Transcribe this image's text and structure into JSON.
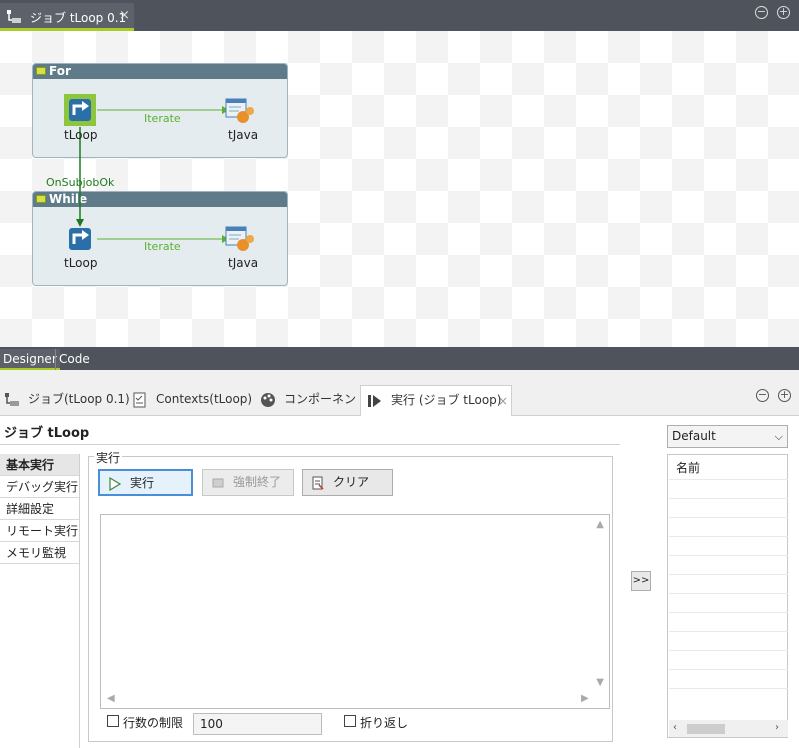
{
  "editor": {
    "tab_title": "ジョブ tLoop 0.1",
    "close_glyph": "×",
    "minimize_glyph": "−",
    "maximize_glyph": "+"
  },
  "canvas": {
    "subjobs": [
      {
        "title": "For",
        "source": "tLoop",
        "target": "tJava",
        "link": "Iterate"
      },
      {
        "title": "While",
        "source": "tLoop",
        "target": "tJava",
        "link": "Iterate"
      }
    ],
    "trigger_label": "OnSubjobOk",
    "tabs": [
      "Designer",
      "Code"
    ]
  },
  "views": {
    "tabs": [
      {
        "label": "ジョブ(tLoop 0.1)",
        "icon": "job-icon"
      },
      {
        "label": "Contexts(tLoop)",
        "icon": "contexts-icon"
      },
      {
        "label": "コンポーネント",
        "icon": "palette-icon"
      },
      {
        "label": "実行 (ジョブ tLoop)",
        "icon": "run-icon",
        "active": true
      }
    ],
    "close_glyph": "×"
  },
  "run_panel": {
    "title": "ジョブ tLoop",
    "nav": [
      "基本実行",
      "デバッグ実行",
      "詳細設定",
      "リモート実行",
      "メモリ監視"
    ],
    "group_label": "実行",
    "buttons": {
      "run": "実行",
      "stop": "強制終了",
      "clear": "クリア"
    },
    "limit_lines_label": "行数の制限",
    "limit_lines_value": "100",
    "wrap_label": "折り返し",
    "expand_label": ">>"
  },
  "context": {
    "selected": "Default",
    "column_header": "名前"
  },
  "colors": {
    "accent_green": "#a9cd24",
    "link_green": "#5ab02f",
    "trigger_green": "#1f7a1f",
    "header_dark": "#4f535b"
  }
}
